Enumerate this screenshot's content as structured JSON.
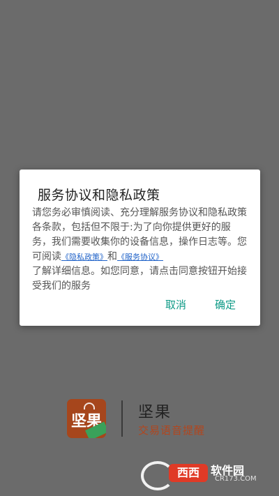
{
  "dialog": {
    "title": "服务协议和隐私政策",
    "body_part1": "请您务必审慎阅读、充分理解服务协议和隐私政策各条款，包括但不限于:为了向你提供更好的服务，我们需要收集你的设备信息，操作日志等。您可阅读",
    "privacy_link": "《隐私政策》",
    "and": "和",
    "service_link": "《服务协议》",
    "body_part2": "了解详细信息。如您同意，请点击同意按钮开始接受我们的服务",
    "cancel": "取消",
    "confirm": "确定"
  },
  "brand": {
    "logo_glyph": "坚果",
    "name": "坚果",
    "subtitle": "交易语音提醒"
  },
  "watermark": {
    "xixi": "西西",
    "text": "软件园",
    "url": "CR173.COM"
  },
  "colors": {
    "overlay": "#6b6b6b",
    "button": "#0e9a86",
    "link": "#1f62c8",
    "brand_accent": "#b2461e",
    "logo_bg": "#a6461c"
  },
  "icons": [
    "app-logo-icon",
    "sound-waves-icon"
  ]
}
